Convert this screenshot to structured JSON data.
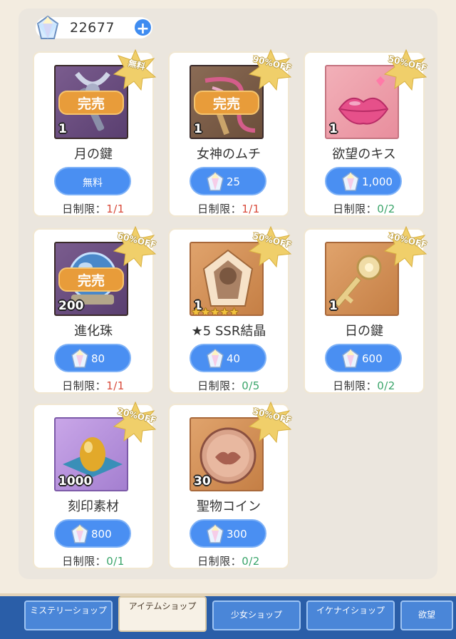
{
  "currency": {
    "amount": "22677",
    "plus": "+"
  },
  "items": [
    {
      "name": "月の鍵",
      "qty": "1",
      "badge": "無料",
      "soldout": "完売",
      "price": "無料",
      "price_is_free": true,
      "limit_label": "日制限：",
      "limit_value": "1/1",
      "limit_color": "red",
      "bg": "purple",
      "icon": "moon-key-icon"
    },
    {
      "name": "女神のムチ",
      "qty": "1",
      "badge": "90%OFF",
      "soldout": "完売",
      "price": "25",
      "limit_label": "日制限：",
      "limit_value": "1/1",
      "limit_color": "red",
      "bg": "brown",
      "icon": "whip-icon"
    },
    {
      "name": "欲望のキス",
      "qty": "1",
      "badge": "50%OFF",
      "soldout": "",
      "price": "1,000",
      "limit_label": "日制限：",
      "limit_value": "0/2",
      "limit_color": "green",
      "bg": "pink",
      "icon": "lips-icon"
    },
    {
      "name": "進化珠",
      "qty": "200",
      "badge": "60%OFF",
      "soldout": "完売",
      "price": "80",
      "limit_label": "日制限：",
      "limit_value": "1/1",
      "limit_color": "red",
      "bg": "purple",
      "icon": "orb-icon"
    },
    {
      "name": "★5 SSR結晶",
      "qty": "1",
      "badge": "50%OFF",
      "soldout": "",
      "stars": "★★★★★",
      "price": "40",
      "limit_label": "日制限：",
      "limit_value": "0/5",
      "limit_color": "green",
      "bg": "tan",
      "icon": "crystal-icon"
    },
    {
      "name": "日の鍵",
      "qty": "1",
      "badge": "40%OFF",
      "soldout": "",
      "price": "600",
      "limit_label": "日制限：",
      "limit_value": "0/2",
      "limit_color": "green",
      "bg": "tan",
      "icon": "sun-key-icon"
    },
    {
      "name": "刻印素材",
      "qty": "1000",
      "badge": "20%OFF",
      "soldout": "",
      "price": "800",
      "limit_label": "日制限：",
      "limit_value": "0/1",
      "limit_color": "green",
      "bg": "violet",
      "icon": "egg-icon"
    },
    {
      "name": "聖物コイン",
      "qty": "30",
      "badge": "50%OFF",
      "soldout": "",
      "price": "300",
      "limit_label": "日制限：",
      "limit_value": "0/2",
      "limit_color": "green",
      "bg": "tan",
      "icon": "coin-icon"
    }
  ],
  "tabs": [
    {
      "label": "ミステリーショップ",
      "active": false
    },
    {
      "label": "アイテムショップ",
      "active": true
    },
    {
      "label": "少女ショップ",
      "active": false
    },
    {
      "label": "イケナイショップ",
      "active": false
    },
    {
      "label": "欲望",
      "active": false
    }
  ],
  "colors": {
    "accent": "#4a8ff2",
    "soldout": "#e89c3a",
    "limit_red": "#d94a3a",
    "limit_green": "#3aa56a"
  }
}
